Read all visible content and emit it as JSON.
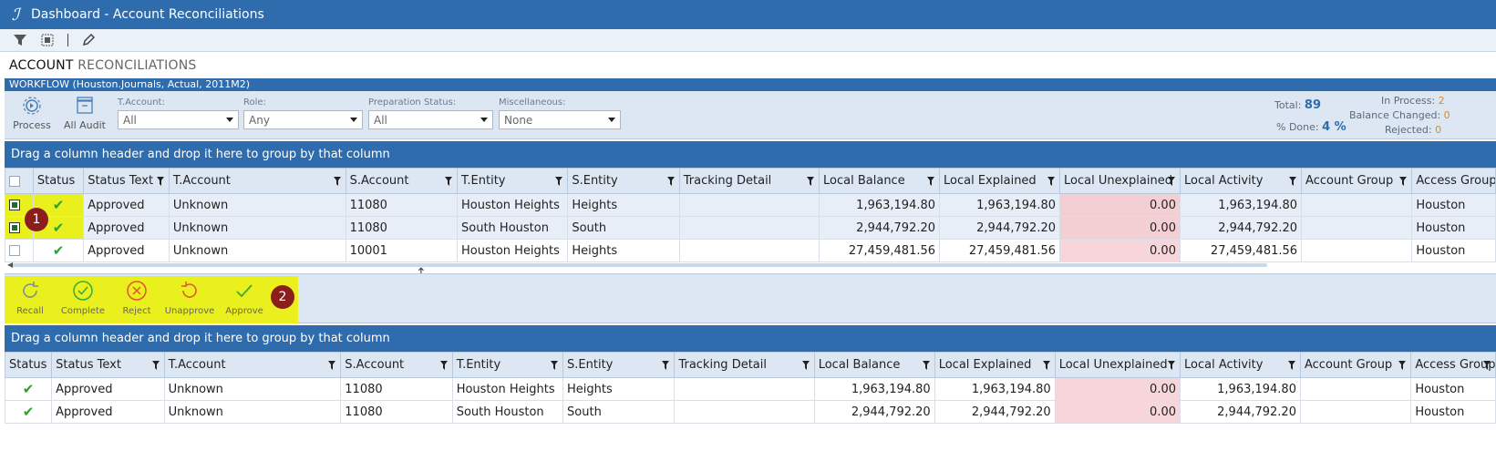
{
  "window": {
    "title": "Dashboard - Account Reconciliations",
    "logo_glyph": "ℐ"
  },
  "toolbar": {
    "icons": [
      "filter-icon",
      "select-all-icon",
      "edit-icon"
    ]
  },
  "page": {
    "heading_bold": "ACCOUNT",
    "heading_light": "RECONCILIATIONS"
  },
  "workflow": {
    "label": "WORKFLOW  (Houston.Journals, Actual, 2011M2)"
  },
  "actions_top": {
    "process_label": "Process",
    "all_audit_label": "All Audit"
  },
  "filters": {
    "t_account": {
      "label": "T.Account:",
      "value": "All"
    },
    "role": {
      "label": "Role:",
      "value": "Any"
    },
    "prep_status": {
      "label": "Preparation Status:",
      "value": "All"
    },
    "misc": {
      "label": "Miscellaneous:",
      "value": "None"
    }
  },
  "stats": {
    "total_label": "Total:",
    "total_value": "89",
    "done_label": "% Done:",
    "done_value": "4 %",
    "in_process_label": "In Process:",
    "in_process_value": "2",
    "balance_changed_label": "Balance Changed:",
    "balance_changed_value": "0",
    "rejected_label": "Rejected:",
    "rejected_value": "0"
  },
  "group_prompt": "Drag a column header and drop it here to group by that column",
  "columns": [
    "Status",
    "Status Text",
    "T.Account",
    "S.Account",
    "T.Entity",
    "S.Entity",
    "Tracking Detail",
    "Local Balance",
    "Local Explained",
    "Local Unexplained",
    "Local Activity",
    "Account Group",
    "Access Group"
  ],
  "top_rows": [
    {
      "checked": true,
      "status_text": "Approved",
      "t_account": "Unknown",
      "s_account": "11080",
      "t_entity": "Houston Heights",
      "s_entity": "Heights",
      "tracking": "",
      "local_balance": "1,963,194.80",
      "local_explained": "1,963,194.80",
      "local_unexplained": "0.00",
      "local_activity": "1,963,194.80",
      "account_group": "",
      "access_group": "Houston"
    },
    {
      "checked": true,
      "status_text": "Approved",
      "t_account": "Unknown",
      "s_account": "11080",
      "t_entity": "South Houston",
      "s_entity": "South",
      "tracking": "",
      "local_balance": "2,944,792.20",
      "local_explained": "2,944,792.20",
      "local_unexplained": "0.00",
      "local_activity": "2,944,792.20",
      "account_group": "",
      "access_group": "Houston"
    },
    {
      "checked": false,
      "status_text": "Approved",
      "t_account": "Unknown",
      "s_account": "10001",
      "t_entity": "Houston Heights",
      "s_entity": "Heights",
      "tracking": "",
      "local_balance": "27,459,481.56",
      "local_explained": "27,459,481.56",
      "local_unexplained": "0.00",
      "local_activity": "27,459,481.56",
      "account_group": "",
      "access_group": "Houston"
    }
  ],
  "bottom_rows": [
    {
      "status_text": "Approved",
      "t_account": "Unknown",
      "s_account": "11080",
      "t_entity": "Houston Heights",
      "s_entity": "Heights",
      "tracking": "",
      "local_balance": "1,963,194.80",
      "local_explained": "1,963,194.80",
      "local_unexplained": "0.00",
      "local_activity": "1,963,194.80",
      "account_group": "",
      "access_group": "Houston"
    },
    {
      "status_text": "Approved",
      "t_account": "Unknown",
      "s_account": "11080",
      "t_entity": "South Houston",
      "s_entity": "South",
      "tracking": "",
      "local_balance": "2,944,792.20",
      "local_explained": "2,944,792.20",
      "local_unexplained": "0.00",
      "local_activity": "2,944,792.20",
      "account_group": "",
      "access_group": "Houston"
    }
  ],
  "status_glyph": "✔",
  "action_buttons": {
    "recall": "Recall",
    "complete": "Complete",
    "reject": "Reject",
    "unapprove": "Unapprove",
    "approve": "Approve"
  },
  "markers": {
    "one": "1",
    "two": "2"
  },
  "colors": {
    "brand": "#2e6cae",
    "highlight": "#e9f01e",
    "approved_check": "#2aa22e",
    "unexplained_bg": "#f6d6da",
    "marker": "#8c1d1d"
  }
}
